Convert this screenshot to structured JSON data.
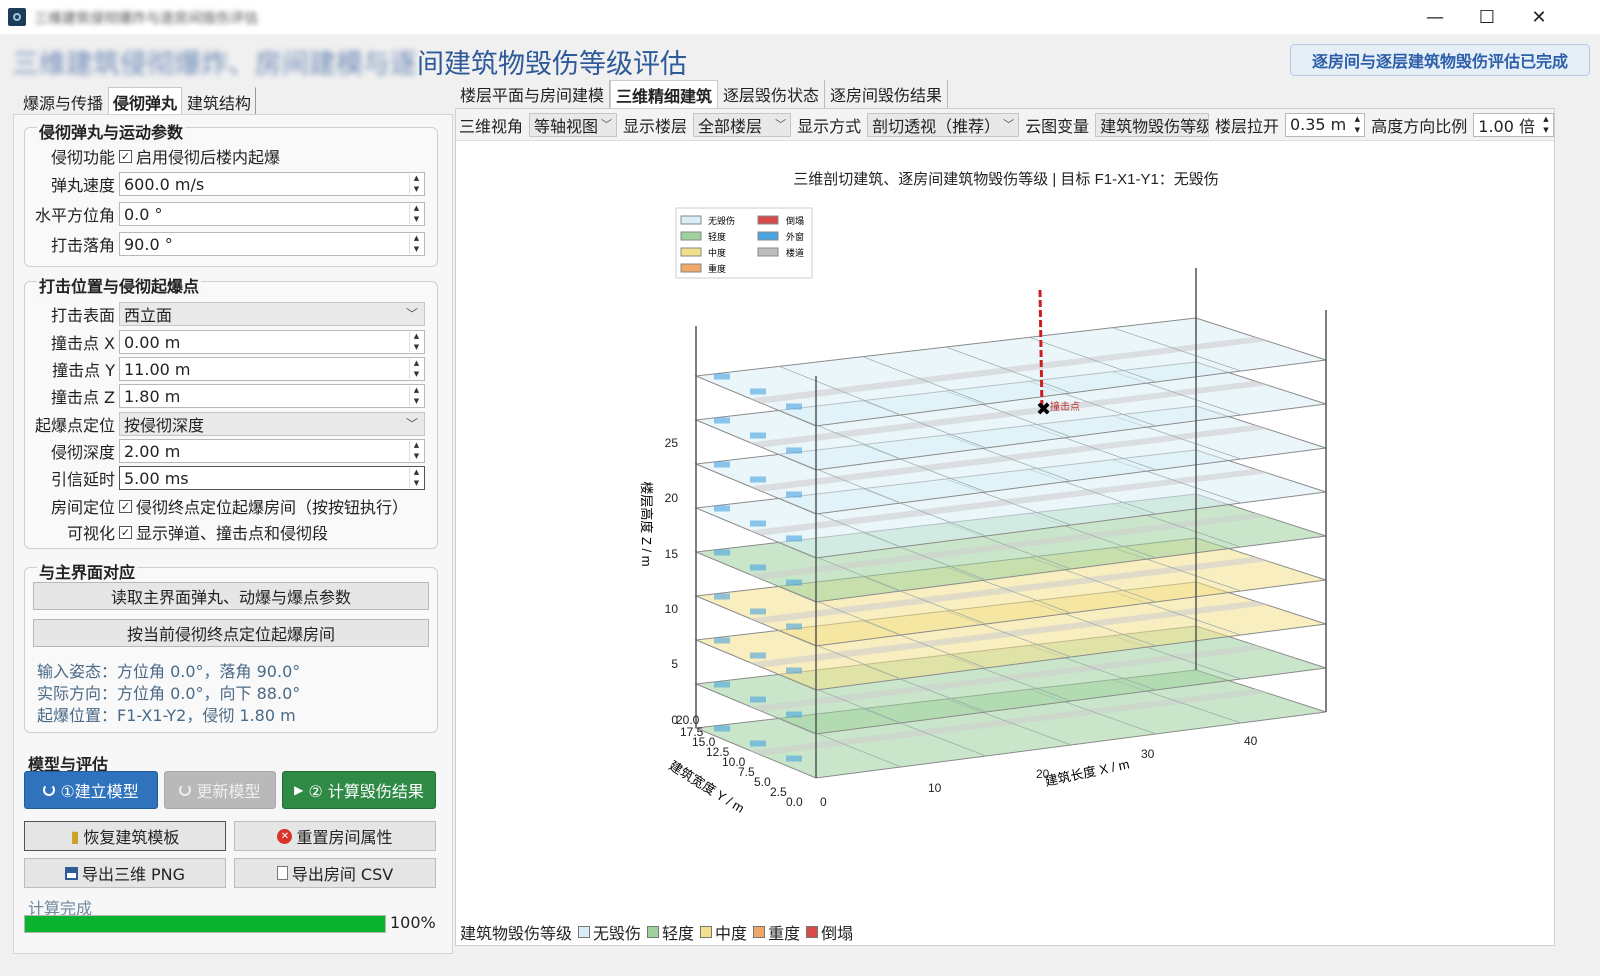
{
  "window": {
    "title": "三维建筑侵彻爆炸与逐房间毁伤评估",
    "minimize": "—",
    "maximize": "☐",
    "close": "✕"
  },
  "header": {
    "title_blurred": "三维建筑侵彻爆炸、房间建模与逐",
    "title_visible": "间建筑物毁伤等级评估",
    "status": "逐房间与逐层建筑物毁伤评估已完成"
  },
  "left_tabs": [
    "爆源与传播",
    "侵彻弹丸",
    "建筑结构"
  ],
  "left_active_tab": 1,
  "group1": {
    "title": "侵彻弹丸与运动参数",
    "fn_label": "侵彻功能",
    "fn_check": "启用侵彻后楼内起爆",
    "speed_label": "弹丸速度",
    "speed_value": "600.0 m/s",
    "azimuth_label": "水平方位角",
    "azimuth_value": "0.0 °",
    "fall_label": "打击落角",
    "fall_value": "90.0 °"
  },
  "group2": {
    "title": "打击位置与侵彻起爆点",
    "surface_label": "打击表面",
    "surface_value": "西立面",
    "x_label": "撞击点 X",
    "x_value": "0.00 m",
    "y_label": "撞击点 Y",
    "y_value": "11.00 m",
    "z_label": "撞击点 Z",
    "z_value": "1.80 m",
    "pos_label": "起爆点定位",
    "pos_value": "按侵彻深度",
    "depth_label": "侵彻深度",
    "depth_value": "2.00 m",
    "delay_label": "引信延时",
    "delay_value": "5.00 ms",
    "room_label": "房间定位",
    "room_check": "侵彻终点定位起爆房间（按按钮执行）",
    "vis_label": "可视化",
    "vis_check": "显示弹道、撞击点和侵彻段"
  },
  "group3": {
    "title": "与主界面对应",
    "btn_read": "读取主界面弹丸、动爆与爆点参数",
    "btn_locate": "按当前侵彻终点定位起爆房间",
    "info1": "输入姿态：方位角 0.0°，落角 90.0°",
    "info2": "实际方向：方位角 0.0°，向下 88.0°",
    "info3": "起爆位置：F1-X1-Y2，侵彻 1.80 m"
  },
  "group4": {
    "title": "模型与评估",
    "btn_build": "①建立模型",
    "btn_update": "更新模型",
    "btn_calc": "② 计算毁伤结果",
    "btn_restore": "恢复建筑模板",
    "btn_reset": "重置房间属性",
    "btn_png": "导出三维 PNG",
    "btn_csv": "导出房间 CSV",
    "status": "计算完成",
    "progress_pct": 100,
    "progress_label": "100%"
  },
  "right_tabs": [
    "楼层平面与房间建模",
    "三维精细建筑",
    "逐层毁伤状态",
    "逐房间毁伤结果"
  ],
  "right_active_tab": 1,
  "toolbar": {
    "view_label": "三维视角",
    "view_value": "等轴视图",
    "floors_label": "显示楼层",
    "floors_value": "全部楼层",
    "mode_label": "显示方式",
    "mode_value": "剖切透视（推荐）",
    "var_label": "云图变量",
    "var_value": "建筑物毁伤等级",
    "spread_label": "楼层拉开",
    "spread_value": "0.35 m",
    "ratio_label": "高度方向比例",
    "ratio_value": "1.00 倍"
  },
  "chart": {
    "title": "三维剖切建筑、逐房间建筑物毁伤等级 | 目标 F1-X1-Y1：无毁伤",
    "legend": [
      {
        "name": "无毁伤",
        "color": "#d9eef6"
      },
      {
        "name": "轻度",
        "color": "#9fd19f"
      },
      {
        "name": "中度",
        "color": "#f3e08a"
      },
      {
        "name": "重度",
        "color": "#f0a868"
      },
      {
        "name": "倒塌",
        "color": "#d84a4a"
      },
      {
        "name": "外窗",
        "color": "#4aa3df"
      },
      {
        "name": "楼道",
        "color": "#bdbdbd"
      }
    ],
    "impact_label": "撞击点",
    "z_axis_label": "楼层高度 Z / m",
    "x_axis_label": "建筑长度 X / m",
    "y_axis_label": "建筑宽度 Y / m",
    "z_ticks": [
      "0",
      "5",
      "10",
      "15",
      "20",
      "25"
    ],
    "x_ticks": [
      "0",
      "10",
      "20",
      "30",
      "40"
    ],
    "y_ticks": [
      "0.0",
      "2.5",
      "5.0",
      "7.5",
      "10.0",
      "12.5",
      "15.0",
      "17.5",
      "20.0"
    ]
  },
  "chart_data": {
    "type": "scatter",
    "title": "三维剖切建筑、逐房间建筑物毁伤等级 | 目标 F1-X1-Y1：无毁伤",
    "xlabel": "建筑长度 X / m",
    "ylabel": "建筑宽度 Y / m",
    "zlabel": "楼层高度 Z / m",
    "xlim": [
      0,
      48
    ],
    "ylim": [
      0,
      20
    ],
    "zlim": [
      0,
      27
    ],
    "floors": 9,
    "floor_damage": [
      "轻度",
      "轻度",
      "中度",
      "中度",
      "轻度",
      "无毁伤",
      "无毁伤",
      "无毁伤",
      "无毁伤"
    ],
    "impact_point": {
      "name": "撞击点"
    }
  },
  "bottom_legend": {
    "label": "建筑物毁伤等级",
    "items": [
      {
        "name": "无毁伤",
        "color": "#d9eef6"
      },
      {
        "name": "轻度",
        "color": "#9fd19f"
      },
      {
        "name": "中度",
        "color": "#f3e08a"
      },
      {
        "name": "重度",
        "color": "#f0a868"
      },
      {
        "name": "倒塌",
        "color": "#d84a4a"
      }
    ]
  }
}
